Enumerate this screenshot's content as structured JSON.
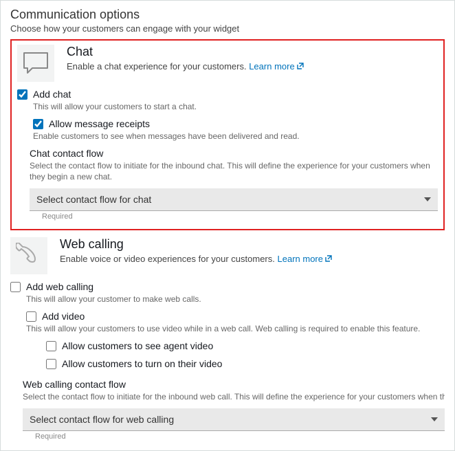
{
  "panel": {
    "title": "Communication options",
    "subtitle": "Choose how your customers can engage with your widget"
  },
  "chat": {
    "title": "Chat",
    "desc": "Enable a chat experience for your customers. ",
    "learn_more": "Learn more",
    "add_label": "Add chat",
    "add_help": "This will allow your customers to start a chat.",
    "receipts_label": "Allow message receipts",
    "receipts_help": "Enable customers to see when messages have been delivered and read.",
    "flow_title": "Chat contact flow",
    "flow_desc": "Select the contact flow to initiate for the inbound chat. This will define the experience for your customers when they begin a new chat.",
    "select_placeholder": "Select contact flow for chat",
    "required": "Required"
  },
  "web": {
    "title": "Web calling",
    "desc": "Enable voice or video experiences for your customers. ",
    "learn_more": "Learn more",
    "add_label": "Add web calling",
    "add_help": "This will allow your customer to make web calls.",
    "video_label": "Add video",
    "video_help": "This will allow your customers to use video while in a web call. Web calling is required to enable this feature.",
    "opt1": "Allow customers to see agent video",
    "opt2": "Allow customers to turn on their video",
    "flow_title": "Web calling contact flow",
    "flow_desc": "Select the contact flow to initiate for the inbound web call. This will define the experience for your customers when they begin a new web call.",
    "select_placeholder": "Select contact flow for web calling",
    "required": "Required"
  }
}
